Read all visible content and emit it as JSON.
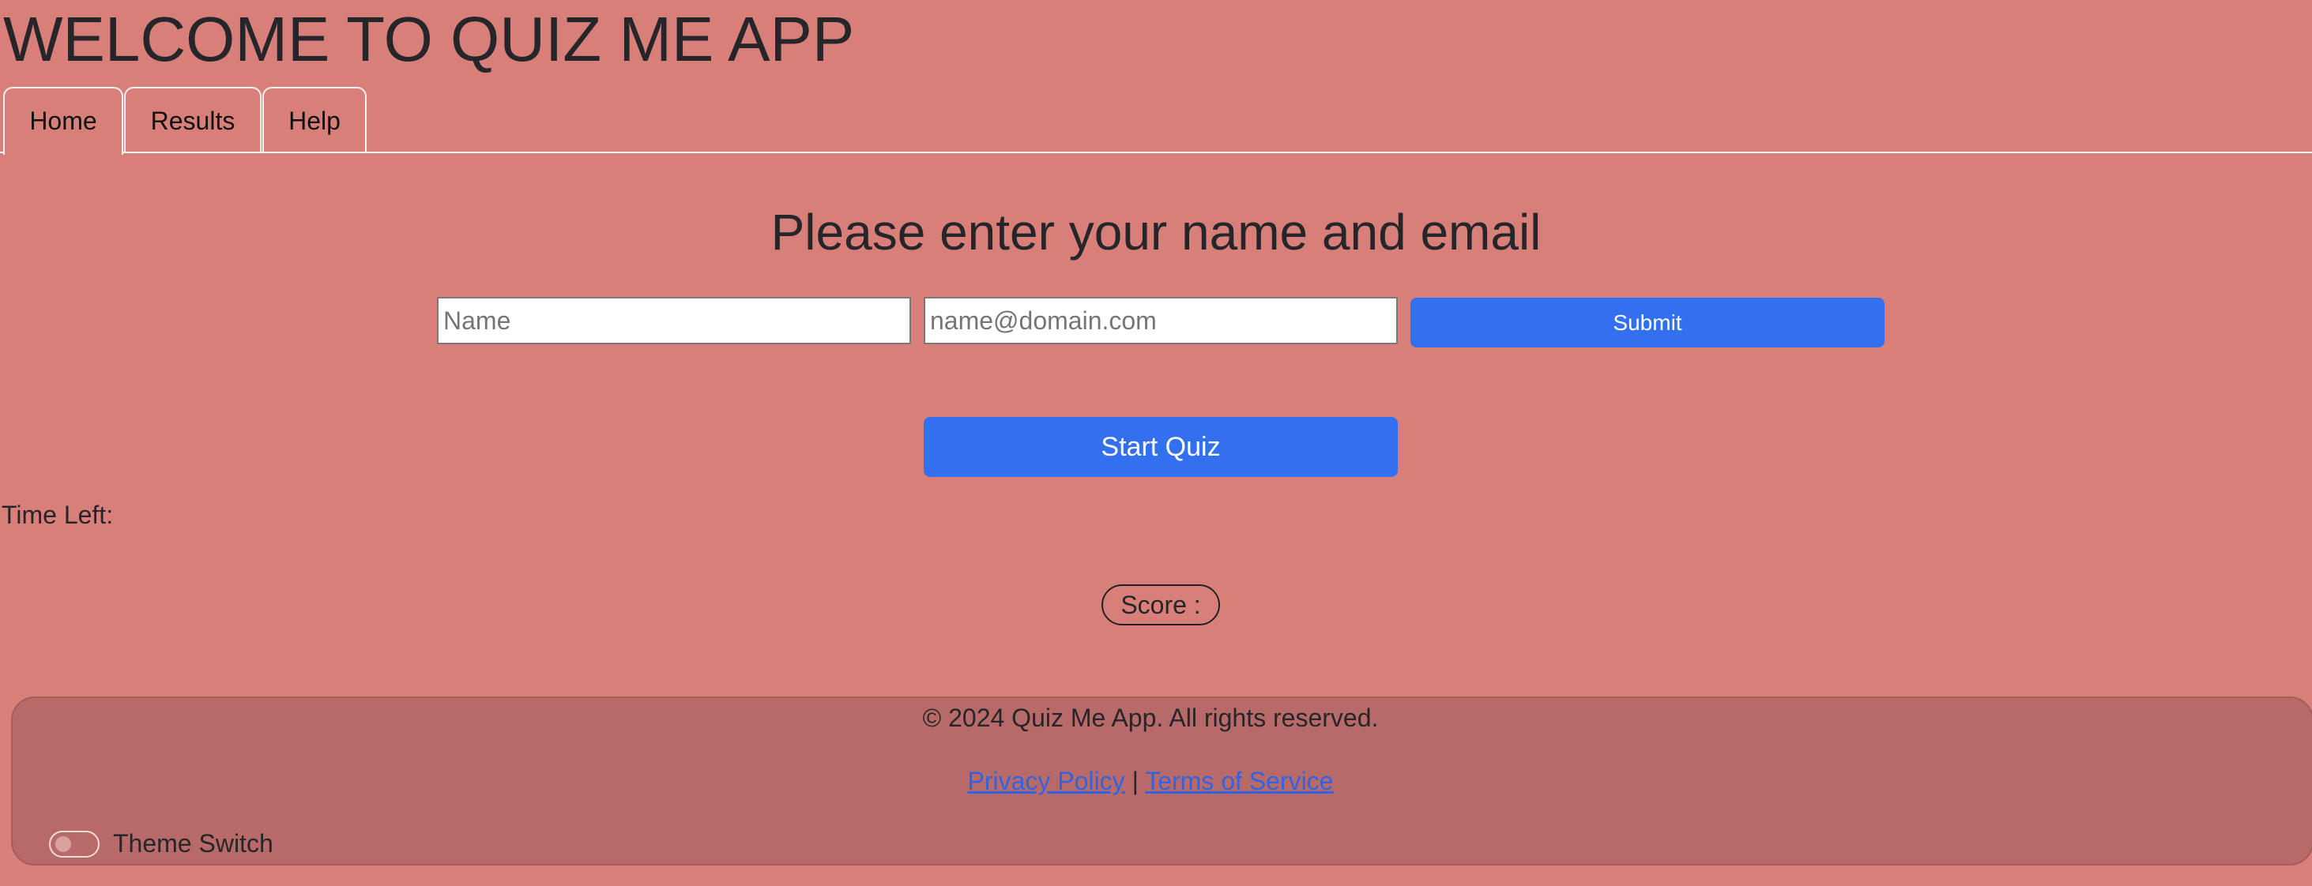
{
  "app": {
    "title": "WELCOME TO QUIZ ME APP"
  },
  "tabs": [
    {
      "label": "Home",
      "active": true
    },
    {
      "label": "Results",
      "active": false
    },
    {
      "label": "Help",
      "active": false
    }
  ],
  "form": {
    "heading": "Please enter your name and email",
    "name_placeholder": "Name",
    "name_value": "",
    "email_placeholder": "name@domain.com",
    "email_value": "",
    "submit_label": "Submit"
  },
  "quiz": {
    "start_label": "Start Quiz",
    "time_left_label": "Time Left:",
    "score_label": "Score :"
  },
  "footer": {
    "copyright": "© 2024 Quiz Me App. All rights reserved.",
    "privacy_label": "Privacy Policy",
    "separator": "|",
    "terms_label": "Terms of Service",
    "theme_switch_label": "Theme Switch",
    "theme_switch_on": false
  },
  "colors": {
    "background": "#d97f7a",
    "footer_background": "#b86a68",
    "primary_button": "#3370f0",
    "link": "#2f63e6",
    "text": "#26262a"
  }
}
